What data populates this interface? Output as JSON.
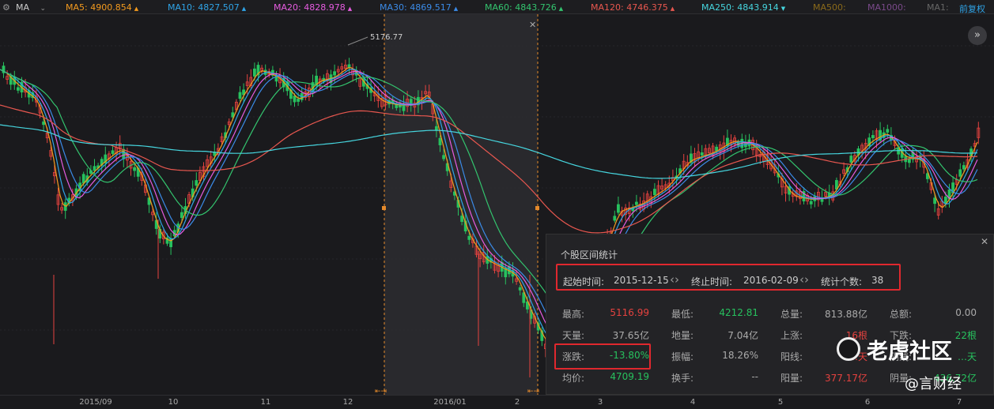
{
  "topbar": {
    "selector": "MA",
    "items": [
      {
        "label": "MA5: 4900.854",
        "color": "#f39a1e",
        "arrow": "▲"
      },
      {
        "label": "MA10: 4827.507",
        "color": "#2fa4e7",
        "arrow": "▲"
      },
      {
        "label": "MA20: 4828.978",
        "color": "#e65ce0",
        "arrow": "▲"
      },
      {
        "label": "MA30: 4869.517",
        "color": "#3b8be8",
        "arrow": "▲"
      },
      {
        "label": "MA60: 4843.726",
        "color": "#33c46e",
        "arrow": "▲"
      },
      {
        "label": "MA120: 4746.375",
        "color": "#e8574f",
        "arrow": "▲"
      },
      {
        "label": "MA250: 4843.914",
        "color": "#46d6df",
        "arrow": "▼"
      },
      {
        "label": "MA500:",
        "color": "#8a6a1a",
        "arrow": ""
      },
      {
        "label": "MA1000:",
        "color": "#7a4a8a",
        "arrow": ""
      },
      {
        "label": "MA1:",
        "color": "#666666",
        "arrow": ""
      }
    ],
    "adjust": "前复权"
  },
  "chart_data": {
    "type": "candlestick",
    "high_label": "5176.77",
    "x_ticks": [
      "2015/09",
      "10",
      "11",
      "12",
      "2016/01",
      "2",
      "3",
      "4",
      "5",
      "6",
      "7"
    ],
    "up_color": "#e5423f",
    "down_color": "#27c15e"
  },
  "panel": {
    "title": "个股区间统计",
    "range": {
      "start_label": "起始时间:",
      "start": "2015-12-15",
      "end_label": "终止时间:",
      "end": "2016-02-09",
      "count_label": "统计个数:",
      "count": "38"
    },
    "stats": [
      {
        "label": "最高:",
        "value": "5116.99",
        "color": "red"
      },
      {
        "label": "最低:",
        "value": "4212.81",
        "color": "green"
      },
      {
        "label": "总量:",
        "value": "813.88亿",
        "color": "lbl"
      },
      {
        "label": "总额:",
        "value": "0.00",
        "color": "lbl"
      },
      {
        "label": "天量:",
        "value": "37.65亿",
        "color": "lbl"
      },
      {
        "label": "地量:",
        "value": "7.04亿",
        "color": "lbl"
      },
      {
        "label": "上涨:",
        "value": "16根",
        "color": "red"
      },
      {
        "label": "下跌:",
        "value": "22根",
        "color": "green"
      },
      {
        "label": "涨跌:",
        "value": "-13.80%",
        "color": "green"
      },
      {
        "label": "振幅:",
        "value": "18.26%",
        "color": "lbl"
      },
      {
        "label": "阳线:",
        "value": "…天",
        "color": "red"
      },
      {
        "label": "阴线:",
        "value": "…天",
        "color": "green"
      },
      {
        "label": "均价:",
        "value": "4709.19",
        "color": "green"
      },
      {
        "label": "换手:",
        "value": "--",
        "color": "lbl"
      },
      {
        "label": "阳量:",
        "value": "377.17亿",
        "color": "red"
      },
      {
        "label": "阴量:",
        "value": "436.72亿",
        "color": "green"
      }
    ]
  },
  "watermark": {
    "brand": "老虎社区",
    "sub": "@言财经"
  },
  "nav_icon": "double-chevron-right-icon"
}
